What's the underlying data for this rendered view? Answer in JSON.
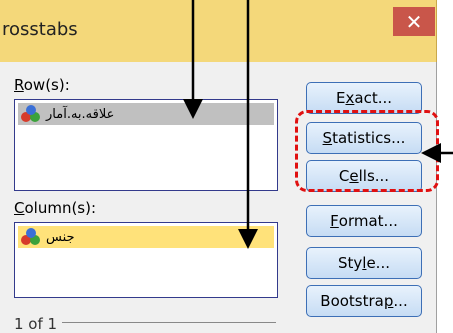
{
  "window": {
    "title": "rosstabs",
    "close_glyph": "✕"
  },
  "rows": {
    "label_prefix": "R",
    "label_rest": "ow(s):",
    "items": [
      "علاقه.به.آمار"
    ]
  },
  "columns": {
    "label_prefix": "C",
    "label_rest": "olumn(s):",
    "items": [
      "جنس"
    ]
  },
  "buttons": [
    {
      "pre": "E",
      "u": "x",
      "post": "act..."
    },
    {
      "pre": "",
      "u": "S",
      "post": "tatistics..."
    },
    {
      "pre": "C",
      "u": "e",
      "post": "lls..."
    },
    {
      "pre": "",
      "u": "F",
      "post": "ormat..."
    },
    {
      "pre": "Sty",
      "u": "l",
      "post": "e..."
    },
    {
      "pre": "Bootstra",
      "u": "p",
      "post": "..."
    }
  ],
  "pager": {
    "text": "1 of 1"
  },
  "colors": {
    "highlight_red": "#e01010",
    "selected_row": "#c0c0c0",
    "selected_col": "#ffe27a"
  },
  "icons": [
    "variable-scale-icon"
  ]
}
